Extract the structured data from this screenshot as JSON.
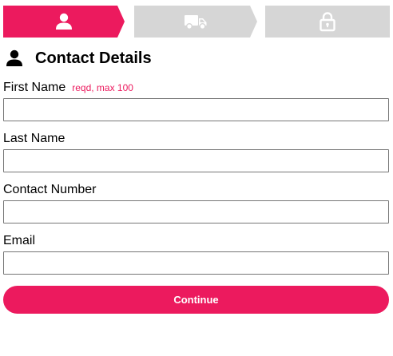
{
  "colors": {
    "accent": "#EC1A5E",
    "inactive_step": "#D6D6D6",
    "icon_on_accent": "#FFFFFF",
    "text": "#000000",
    "border": "#767676"
  },
  "steps": [
    {
      "icon": "person-icon",
      "active": true
    },
    {
      "icon": "truck-icon",
      "active": false
    },
    {
      "icon": "lock-icon",
      "active": false
    }
  ],
  "section": {
    "icon": "person-icon",
    "title": "Contact Details"
  },
  "form": {
    "first_name": {
      "label": "First Name",
      "hint": "reqd, max 100",
      "value": "",
      "placeholder": ""
    },
    "last_name": {
      "label": "Last Name",
      "value": "",
      "placeholder": ""
    },
    "contact_number": {
      "label": "Contact Number",
      "value": "",
      "placeholder": ""
    },
    "email": {
      "label": "Email",
      "value": "",
      "placeholder": ""
    }
  },
  "continue_label": "Continue"
}
